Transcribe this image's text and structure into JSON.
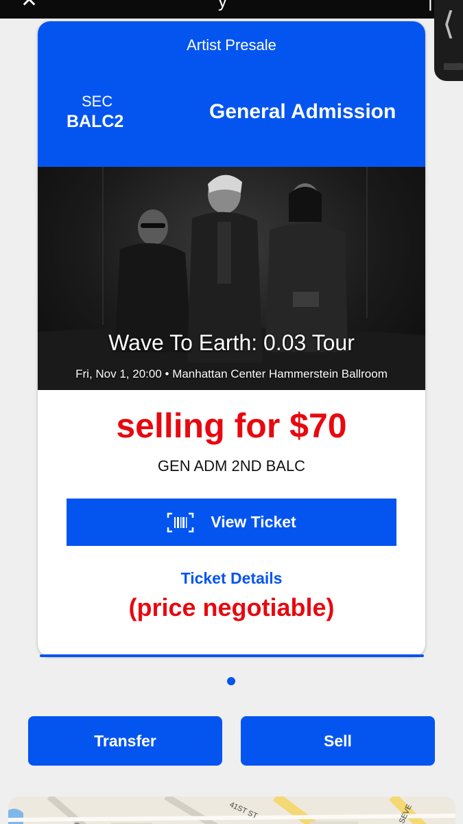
{
  "topbar": {
    "close_icon": "close-icon",
    "title_fragment": "y",
    "title_fragment_right": "|"
  },
  "side_handle": {
    "icon": "chevron-left-icon",
    "glyph": "⟨"
  },
  "ticket": {
    "header": {
      "presale": "Artist Presale",
      "sec_label": "SEC",
      "sec_value": "BALC2",
      "admission": "General Admission"
    },
    "event": {
      "title": "Wave To Earth: 0.03 Tour",
      "meta": "Fri, Nov 1, 20:00 • Manhattan Center Hammerstein Ballroom"
    },
    "price_text": "selling for $70",
    "row_label": "GEN ADM 2ND BALC",
    "view_ticket_label": "View Ticket",
    "view_ticket_icon": "barcode-icon",
    "ticket_details_label": "Ticket Details",
    "negotiable_text": "(price negotiable)"
  },
  "actions": {
    "transfer_label": "Transfer",
    "sell_label": "Sell"
  },
  "map": {
    "street_label": "41ST ST",
    "street_label_2": "SEVE"
  },
  "colors": {
    "accent": "#0455f0",
    "price_red": "#e8080f",
    "background": "#efefef"
  }
}
